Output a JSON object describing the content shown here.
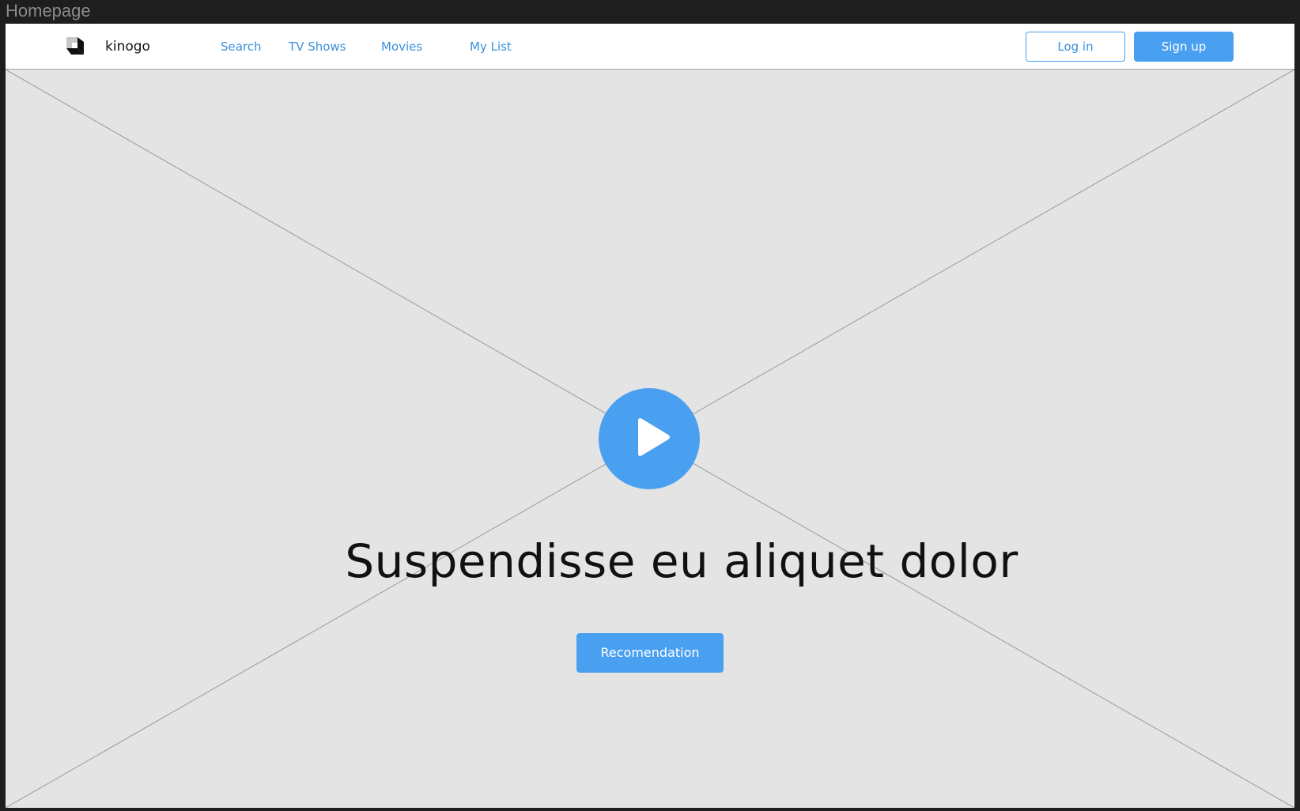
{
  "frame": {
    "label": "Homepage"
  },
  "navbar": {
    "brand": "kinogo",
    "logo_icon": "cube-logo-icon",
    "links": [
      "Search",
      "TV Shows",
      "Movies",
      "My List"
    ],
    "login_label": "Log in",
    "signup_label": "Sign up"
  },
  "hero": {
    "placeholder_icon": "image-placeholder-icon",
    "play_icon": "play-icon",
    "headline": "Suspendisse eu aliquet dolor",
    "cta_label": "Recomendation"
  },
  "colors": {
    "accent": "#4aa0f0",
    "link": "#3a8fdc",
    "hero_bg": "#e4e4e4",
    "canvas_bg": "#1e1e1e"
  }
}
